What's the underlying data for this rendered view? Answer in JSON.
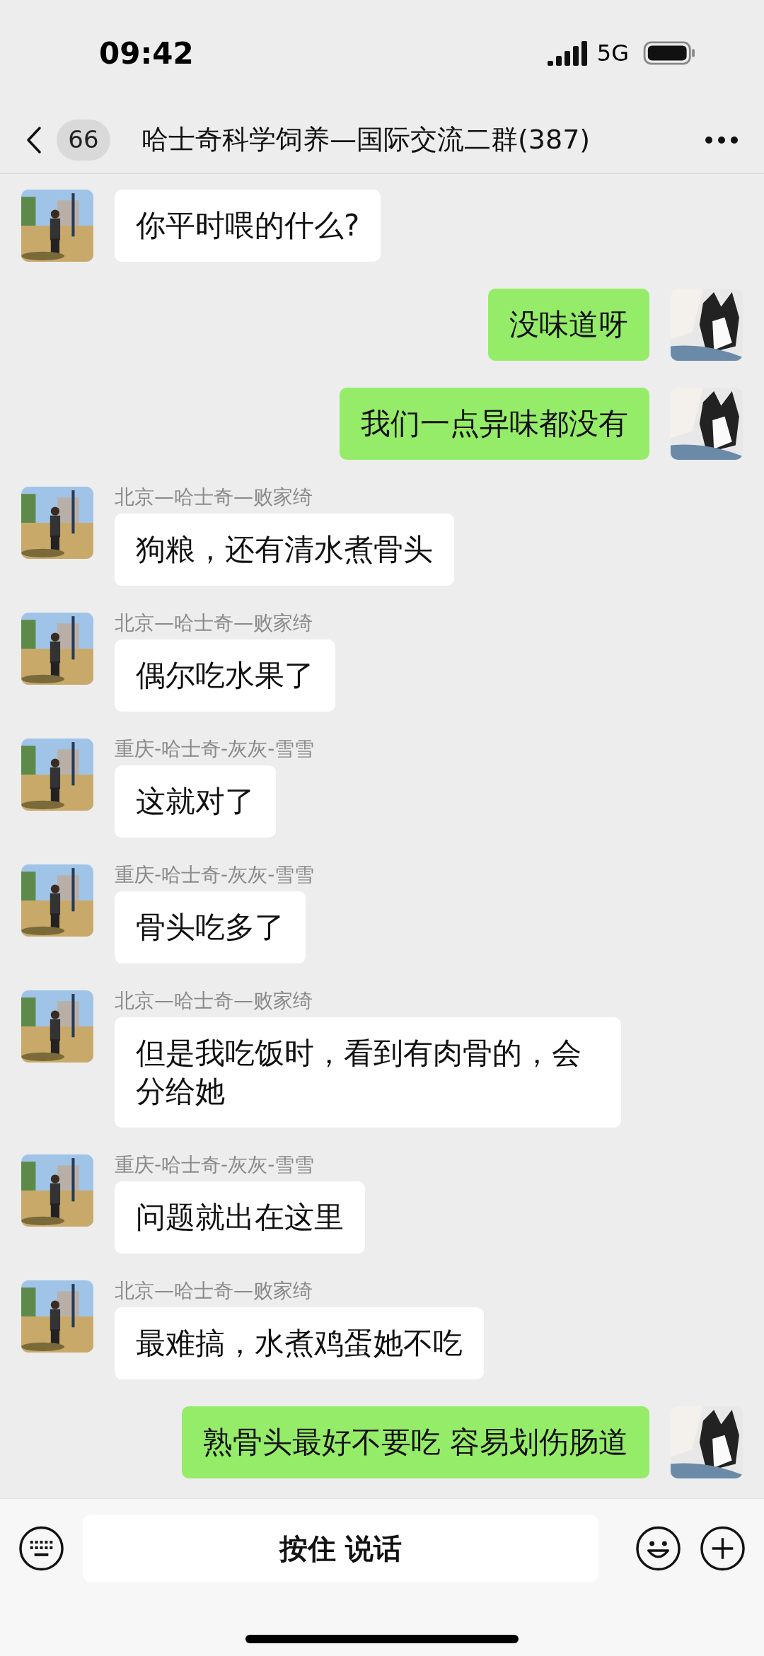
{
  "status_bar": {
    "time": "09:42",
    "network": "5G"
  },
  "header": {
    "unread_badge": "66",
    "title": "哈士奇科学饲养—国际交流二群(387)"
  },
  "messages": [
    {
      "kind": "incoming",
      "text": "你平时喂的什么?"
    },
    {
      "kind": "outgoing",
      "text": "没味道呀"
    },
    {
      "kind": "outgoing",
      "text": "我们一点异味都没有"
    },
    {
      "kind": "incoming",
      "sender": "北京—哈士奇—败家绮",
      "text": "狗粮，还有清水煮骨头"
    },
    {
      "kind": "incoming",
      "sender": "北京—哈士奇—败家绮",
      "text": "偶尔吃水果了"
    },
    {
      "kind": "incoming",
      "sender": "重庆-哈士奇-灰灰-雪雪",
      "text": "这就对了"
    },
    {
      "kind": "incoming",
      "sender": "重庆-哈士奇-灰灰-雪雪",
      "text": "骨头吃多了"
    },
    {
      "kind": "incoming",
      "sender": "北京—哈士奇—败家绮",
      "text": "但是我吃饭时，看到有肉骨的，会分给她"
    },
    {
      "kind": "incoming",
      "sender": "重庆-哈士奇-灰灰-雪雪",
      "text": "问题就出在这里"
    },
    {
      "kind": "incoming",
      "sender": "北京—哈士奇—败家绮",
      "text": "最难搞，水煮鸡蛋她不吃"
    },
    {
      "kind": "outgoing",
      "text": "熟骨头最好不要吃 容易划伤肠道"
    }
  ],
  "input_bar": {
    "hold_to_talk": "按住 说话"
  }
}
